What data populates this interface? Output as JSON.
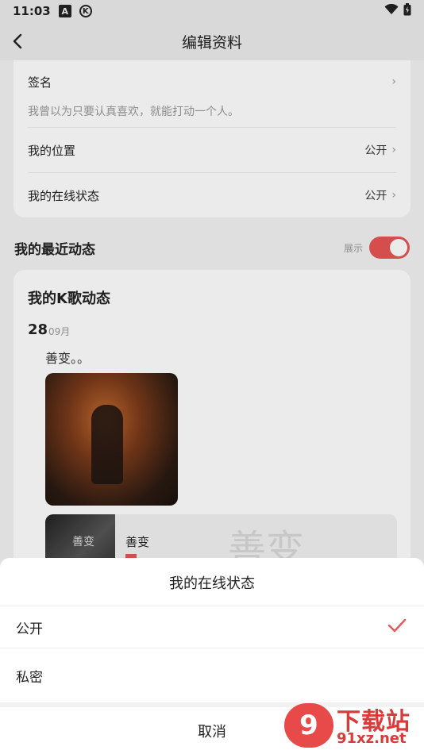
{
  "status_bar": {
    "time": "11:03",
    "icon_a": "A",
    "icon_k": "K"
  },
  "nav": {
    "title": "编辑资料"
  },
  "profile": {
    "signature_label": "签名",
    "signature_value": "我曾以为只要认真喜欢，就能打动一个人。",
    "location_label": "我的位置",
    "location_value": "公开",
    "online_label": "我的在线状态",
    "online_value": "公开"
  },
  "recent": {
    "title": "我的最近动态",
    "toggle_label": "展示",
    "toggle_on": true
  },
  "ksong": {
    "title": "我的K歌动态",
    "day": "28",
    "month": "09月",
    "post_text": "善变。。",
    "song_name": "善变",
    "cover_text": "善变",
    "cover_watermark": "善变"
  },
  "sheet": {
    "title": "我的在线状态",
    "options": [
      {
        "label": "公开",
        "selected": true
      },
      {
        "label": "私密",
        "selected": false
      }
    ],
    "cancel": "取消"
  },
  "logo": {
    "number": "9",
    "cn": "下载站",
    "url": "91xz.net"
  },
  "colors": {
    "accent": "#e85555"
  }
}
